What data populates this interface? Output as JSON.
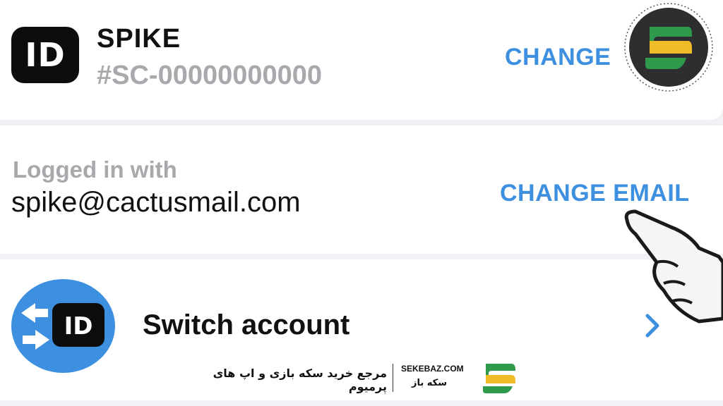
{
  "account": {
    "name": "SPIKE",
    "code": "#SC-00000000000",
    "badge_text": "ID",
    "change_label": "CHANGE"
  },
  "login": {
    "label": "Logged in with",
    "email": "spike@cactusmail.com",
    "change_email_label": "CHANGE EMAIL"
  },
  "switch": {
    "label": "Switch account",
    "badge_text": "ID"
  },
  "watermark": {
    "site": "SEKEBAZ.COM",
    "brand": "سکه باز",
    "tagline": "مرجع خرید سکه بازی و اپ های پرمیوم"
  },
  "colors": {
    "accent": "#3d8fe0",
    "muted": "#a8a8ad",
    "text": "#111111",
    "background": "#f2f2f6"
  }
}
